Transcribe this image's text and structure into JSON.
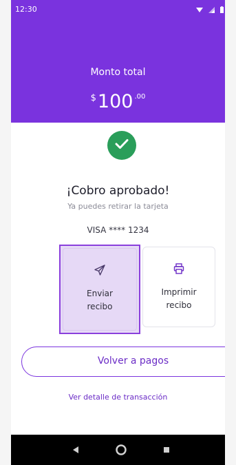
{
  "status_bar": {
    "time": "12:30",
    "icons": [
      "wifi-icon",
      "signal-icon",
      "battery-icon"
    ]
  },
  "header": {
    "amount_label": "Monto total",
    "currency": "$",
    "amount_int": "100",
    "amount_dec": ".00"
  },
  "result": {
    "icon": "check-icon",
    "title": "¡Cobro aprobado!",
    "subtitle": "Ya puedes retirar la tarjeta",
    "card": "VISA **** 1234"
  },
  "actions": {
    "send": {
      "icon": "send-icon",
      "line1": "Enviar",
      "line2": "recibo"
    },
    "print": {
      "icon": "printer-icon",
      "line1": "Imprimir",
      "line2": "recibo"
    }
  },
  "back_button_label": "Volver a pagos",
  "detail_link": "Ver detalle de transacción",
  "navbar": {
    "icons": [
      "back-icon",
      "home-icon",
      "recents-icon"
    ]
  },
  "colors": {
    "brand": "#7a33de",
    "success": "#2a9e5a",
    "selected_bg": "#e6d9f6"
  }
}
